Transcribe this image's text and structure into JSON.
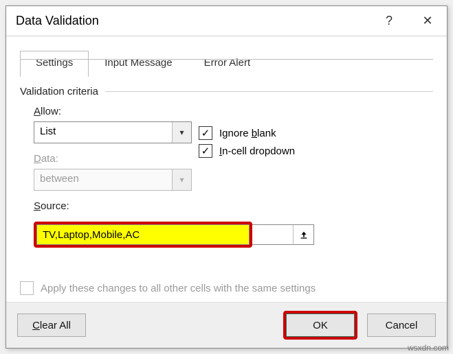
{
  "dialog": {
    "title": "Data Validation",
    "help_glyph": "?",
    "close_glyph": "✕"
  },
  "tabs": {
    "settings": "Settings",
    "input_message": "Input Message",
    "error_alert": "Error Alert"
  },
  "settings": {
    "group_label": "Validation criteria",
    "allow_label_pre": "A",
    "allow_label_post": "llow:",
    "allow_value": "List",
    "data_label_pre": "D",
    "data_label_post": "ata:",
    "data_value": "between",
    "ignore_blank_pre": "Ignore ",
    "ignore_blank_ul": "b",
    "ignore_blank_post": "lank",
    "incell_pre": "I",
    "incell_post": "n-cell dropdown",
    "source_label_pre": "S",
    "source_label_post": "ource:",
    "source_value": "TV,Laptop,Mobile,AC",
    "apply_pre": "Apply these changes to all other cells with the same settings",
    "dd_glyph": "▾",
    "check_glyph": "✓"
  },
  "footer": {
    "clear_pre": "C",
    "clear_post": "lear All",
    "ok": "OK",
    "cancel": "Cancel"
  },
  "watermark": "wsxdn.com"
}
